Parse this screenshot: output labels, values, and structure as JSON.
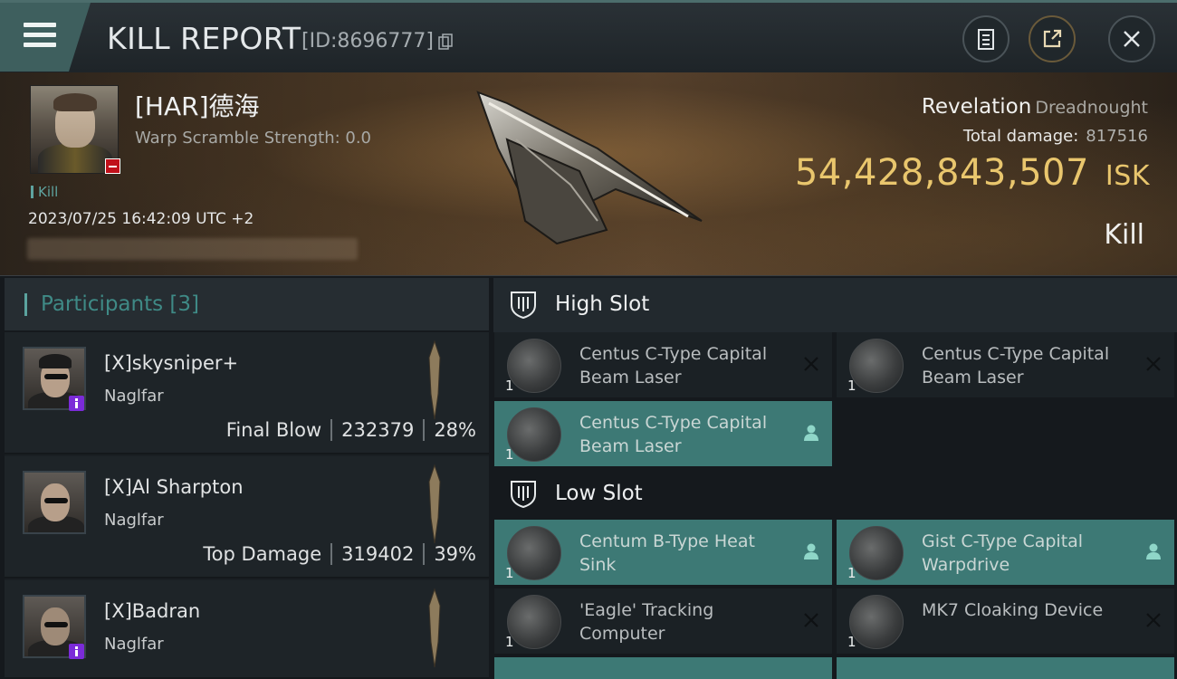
{
  "header": {
    "title": "KILL REPORT",
    "report_id": "[ID:8696777]"
  },
  "victim": {
    "name": "[HAR]德海",
    "warp_scramble": "Warp Scramble Strength: 0.0",
    "tag": "Kill",
    "datetime": "2023/07/25 16:42:09 UTC +2",
    "ship_name": "Revelation",
    "ship_class": "Dreadnought",
    "total_damage_label": "Total damage:",
    "total_damage": "817516",
    "isk_value": "54,428,843,507",
    "isk_unit": "ISK",
    "result": "Kill"
  },
  "participants": {
    "title": "Participants [3]",
    "items": [
      {
        "name": "[X]skysniper+",
        "ship": "Naglfar",
        "role": "Final Blow",
        "damage": "232379",
        "percent": "28%"
      },
      {
        "name": "[X]Al Sharpton",
        "ship": "Naglfar",
        "role": "Top Damage",
        "damage": "319402",
        "percent": "39%"
      },
      {
        "name": "[X]Badran",
        "ship": "Naglfar",
        "role": "",
        "damage": "",
        "percent": ""
      }
    ]
  },
  "slots": {
    "high": {
      "label": "High Slot",
      "modules": [
        {
          "name": "Centus C-Type Capital Beam Laser",
          "qty": "1",
          "status": "destroyed"
        },
        {
          "name": "Centus C-Type Capital Beam Laser",
          "qty": "1",
          "status": "destroyed"
        },
        {
          "name": "Centus C-Type Capital Beam Laser",
          "qty": "1",
          "status": "dropped"
        }
      ]
    },
    "low": {
      "label": "Low Slot",
      "modules": [
        {
          "name": "Centum B-Type Heat Sink",
          "qty": "1",
          "status": "dropped"
        },
        {
          "name": "Gist C-Type Capital Warpdrive",
          "qty": "1",
          "status": "dropped"
        },
        {
          "name": "'Eagle' Tracking Computer",
          "qty": "1",
          "status": "destroyed"
        },
        {
          "name": "MK7 Cloaking Device",
          "qty": "1",
          "status": "destroyed"
        }
      ]
    }
  },
  "colors": {
    "accent_teal": "#3d7975",
    "isk_gold": "#e9c66d",
    "criminal_red": "#c0101a",
    "badge_purple": "#7b2bd8"
  },
  "icons": [
    "hamburger-icon",
    "copy-icon",
    "clipboard-icon",
    "share-icon",
    "close-icon",
    "shield-slot-icon",
    "x-icon",
    "user-icon"
  ]
}
